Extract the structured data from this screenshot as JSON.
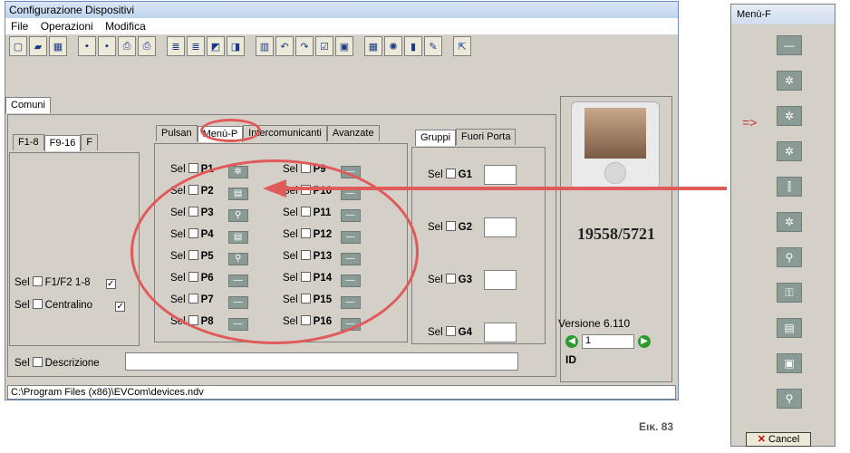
{
  "window": {
    "title": "Configurazione Dispositivi"
  },
  "menu": [
    "File",
    "Operazioni",
    "Modifica"
  ],
  "top_tabs": [
    "Comuni"
  ],
  "left_tabs": [
    "F1-8",
    "F9-16",
    "F"
  ],
  "left_rows": [
    {
      "sel": "Sel",
      "label": "F1/F2 1-8",
      "checked": "✓"
    },
    {
      "sel": "Sel",
      "label": "Centralino",
      "checked": "✓"
    }
  ],
  "mid_tabs": [
    "Pulsan",
    "Menù-P",
    "Intercomunicanti",
    "Avanzate"
  ],
  "p_col1": [
    {
      "sel": "Sel",
      "label": "P1",
      "icon": "✲"
    },
    {
      "sel": "Sel",
      "label": "P2",
      "icon": "▤"
    },
    {
      "sel": "Sel",
      "label": "P3",
      "icon": "⚲"
    },
    {
      "sel": "Sel",
      "label": "P4",
      "icon": "▤"
    },
    {
      "sel": "Sel",
      "label": "P5",
      "icon": "⚲"
    },
    {
      "sel": "Sel",
      "label": "P6",
      "icon": "—"
    },
    {
      "sel": "Sel",
      "label": "P7",
      "icon": "—"
    },
    {
      "sel": "Sel",
      "label": "P8",
      "icon": "—"
    }
  ],
  "p_col2": [
    {
      "sel": "Sel",
      "label": "P9",
      "icon": "—"
    },
    {
      "sel": "Sel",
      "label": "P10",
      "icon": "—"
    },
    {
      "sel": "Sel",
      "label": "P11",
      "icon": "—"
    },
    {
      "sel": "Sel",
      "label": "P12",
      "icon": "—"
    },
    {
      "sel": "Sel",
      "label": "P13",
      "icon": "—"
    },
    {
      "sel": "Sel",
      "label": "P14",
      "icon": "—"
    },
    {
      "sel": "Sel",
      "label": "P15",
      "icon": "—"
    },
    {
      "sel": "Sel",
      "label": "P16",
      "icon": "—"
    }
  ],
  "group_tabs": [
    "Gruppi",
    "Fuori Porta"
  ],
  "groups": [
    {
      "sel": "Sel",
      "label": "G1"
    },
    {
      "sel": "Sel",
      "label": "G2"
    },
    {
      "sel": "Sel",
      "label": "G3"
    },
    {
      "sel": "Sel",
      "label": "G4"
    }
  ],
  "device": {
    "code": "19558/5721",
    "version": "Versione 6.110",
    "id_value": "1",
    "id_label": "ID"
  },
  "description": {
    "sel": "Sel",
    "label": "Descrizione"
  },
  "status_path": "C:\\Program Files (x86)\\EVCom\\devices.ndv",
  "figure_label": "Εικ. 83",
  "right_panel": {
    "title": "Menù-F",
    "arrow": "=>",
    "icons": [
      "—",
      "✲",
      "✲",
      "✲",
      "⫿",
      "✲",
      "⚲",
      "⚿",
      "▤",
      "▣",
      "⚲"
    ],
    "cancel": "Cancel"
  },
  "colors": {
    "highlight": "#e05a5a",
    "icon_bg": "#8a9a95"
  }
}
